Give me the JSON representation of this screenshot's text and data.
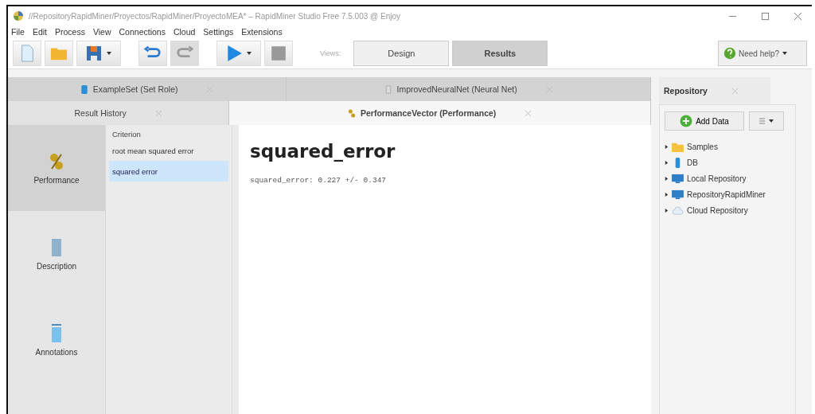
{
  "window": {
    "title": "//RepositoryRapidMiner/Proyectos/RapidMiner/ProyectoMEA* – RapidMiner Studio Free 7.5.003 @ Enjoy"
  },
  "menu": [
    "File",
    "Edit",
    "Process",
    "View",
    "Connections",
    "Cloud",
    "Settings",
    "Extensions"
  ],
  "toolbar": {
    "views_label": "Views:",
    "views": [
      {
        "label": "Design",
        "selected": false
      },
      {
        "label": "Results",
        "selected": true
      }
    ],
    "help": "Need help?"
  },
  "tab_rows": [
    [
      {
        "label": "ExampleSet (Set Role)",
        "kind": "data",
        "selected": false
      },
      {
        "label": "ImprovedNeuralNet (Neural Net)",
        "kind": "model",
        "selected": false
      }
    ],
    [
      {
        "label": "Result History",
        "kind": "history",
        "selected": false
      },
      {
        "label": "PerformanceVector (Performance)",
        "kind": "perf",
        "selected": true
      }
    ]
  ],
  "side_nav": [
    {
      "label": "Performance",
      "kind": "perf",
      "selected": true
    },
    {
      "label": "Description",
      "kind": "doc",
      "selected": false
    },
    {
      "label": "Annotations",
      "kind": "note",
      "selected": false
    }
  ],
  "criterion": {
    "label": "Criterion",
    "items": [
      {
        "label": "root mean squared error",
        "selected": false
      },
      {
        "label": "squared error",
        "selected": true
      }
    ]
  },
  "result": {
    "heading": "squared_error",
    "value": "squared_error: 0.227 +/- 0.347"
  },
  "repository": {
    "title": "Repository",
    "add_button": "Add Data",
    "items": [
      {
        "label": "Samples",
        "kind": "folder"
      },
      {
        "label": "DB",
        "kind": "db"
      },
      {
        "label": "Local Repository",
        "kind": "repo"
      },
      {
        "label": "RepositoryRapidMiner",
        "kind": "repo"
      },
      {
        "label": "Cloud Repository",
        "kind": "cloud"
      }
    ]
  }
}
